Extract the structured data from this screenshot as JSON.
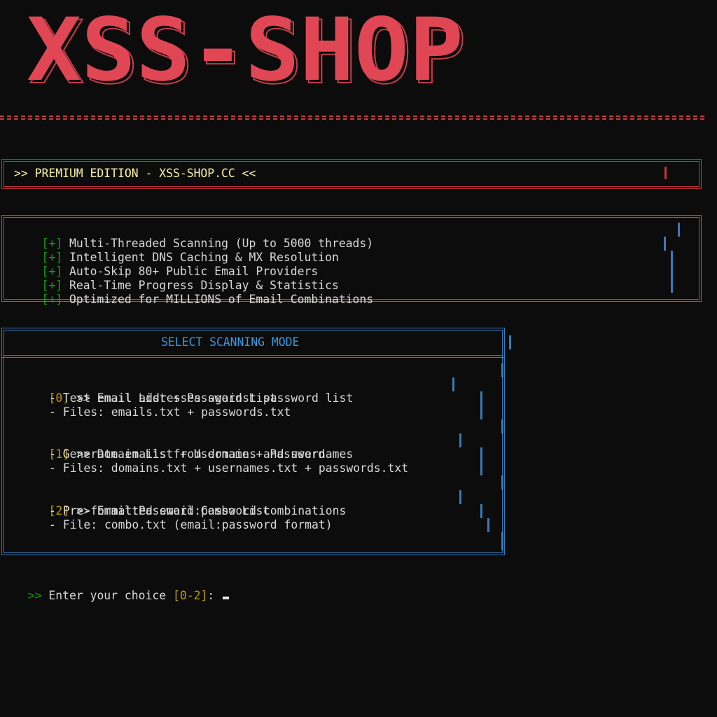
{
  "logo": {
    "text": "XSS-SHOP",
    "color": "#e04654"
  },
  "banner": {
    "text": ">> PREMIUM EDITION - XSS-SHOP.CC <<"
  },
  "features": {
    "marker": "[+]",
    "items": [
      "Multi-Threaded Scanning (Up to 5000 threads)",
      "Intelligent DNS Caching & MX Resolution",
      "Auto-Skip 80+ Public Email Providers",
      "Real-Time Progress Display & Statistics",
      "Optimized for MILLIONS of Email Combinations"
    ]
  },
  "menu": {
    "title": "SELECT SCANNING MODE",
    "options": [
      {
        "key": "[0]",
        "label": ">> Email List + Password List",
        "details": [
          "- Test email addresses against password list",
          "- Files: emails.txt + passwords.txt"
        ]
      },
      {
        "key": "[1]",
        "label": ">> Domain List + Username + Password",
        "details": [
          "- Generate emails from domains and usernames",
          "- Files: domains.txt + usernames.txt + passwords.txt"
        ]
      },
      {
        "key": "[2]",
        "label": ">> Email:Password Combo List",
        "details": [
          "- Pre-formatted email:password combinations",
          "- File: combo.txt (email:password format)"
        ]
      }
    ]
  },
  "prompt": {
    "arrow": ">>",
    "text": " Enter your choice ",
    "range": "[0-2]",
    "suffix": ": "
  },
  "colors": {
    "background": "#0c0c0c",
    "red": "#c5343e",
    "blue": "#3a7ab8",
    "gold": "#c19c00",
    "green": "#13a10e",
    "cyan": "#3a96dd",
    "yellow": "#f9f1a5"
  }
}
